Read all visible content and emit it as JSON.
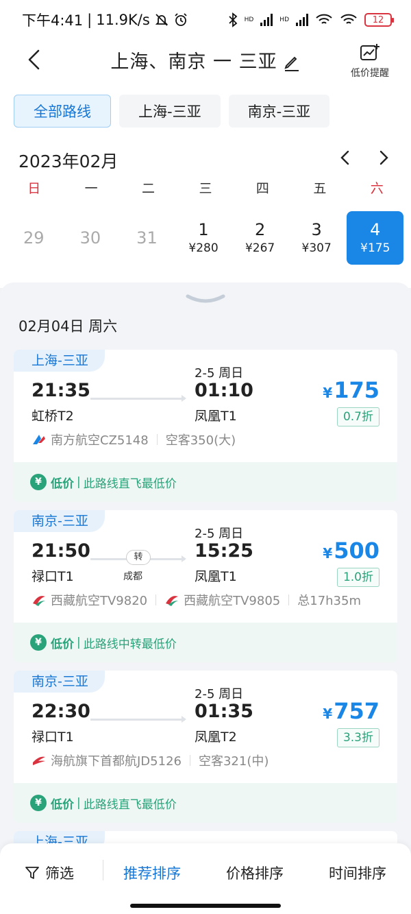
{
  "status_bar": {
    "time": "下午4:41",
    "speed": "11.9K/s",
    "battery": "12",
    "hd1": "HD",
    "hd2": "HD"
  },
  "header": {
    "title": "上海、南京 一 三亚",
    "alert_label": "低价提醒"
  },
  "route_tabs": [
    {
      "label": "全部路线",
      "active": true
    },
    {
      "label": "上海-三亚",
      "active": false
    },
    {
      "label": "南京-三亚",
      "active": false
    }
  ],
  "calendar": {
    "month": "2023年02月",
    "weekdays": [
      "日",
      "一",
      "二",
      "三",
      "四",
      "五",
      "六"
    ],
    "days": [
      {
        "num": "29",
        "price": ""
      },
      {
        "num": "30",
        "price": ""
      },
      {
        "num": "31",
        "price": ""
      },
      {
        "num": "1",
        "price": "¥280"
      },
      {
        "num": "2",
        "price": "¥267"
      },
      {
        "num": "3",
        "price": "¥307"
      },
      {
        "num": "4",
        "price": "¥175"
      }
    ]
  },
  "results": {
    "date_heading": "02月04日 周六",
    "flights": [
      {
        "route": "上海-三亚",
        "dep_time": "21:35",
        "dep_airport": "虹桥T2",
        "arr_date": "2-5 周日",
        "arr_time": "01:10",
        "arr_airport": "凤凰T1",
        "price_symbol": "¥",
        "price": "175",
        "discount": "0.7折",
        "airline": "南方航空CZ5148",
        "aircraft": "空客350(大)",
        "tag_strong": "低价",
        "tag_text": "此路线直飞最低价"
      },
      {
        "route": "南京-三亚",
        "dep_time": "21:50",
        "dep_airport": "禄口T1",
        "arr_date": "2-5 周日",
        "arr_time": "15:25",
        "arr_airport": "凤凰T1",
        "transfer": "转",
        "transfer_city": "成都",
        "price_symbol": "¥",
        "price": "500",
        "discount": "1.0折",
        "airline": "西藏航空TV9820",
        "airline2": "西藏航空TV9805",
        "duration": "总17h35m",
        "tag_strong": "低价",
        "tag_text": "此路线中转最低价"
      },
      {
        "route": "南京-三亚",
        "dep_time": "22:30",
        "dep_airport": "禄口T1",
        "arr_date": "2-5 周日",
        "arr_time": "01:35",
        "arr_airport": "凤凰T2",
        "price_symbol": "¥",
        "price": "757",
        "discount": "3.3折",
        "airline": "海航旗下首都航JD5126",
        "aircraft": "空客321(中)",
        "tag_strong": "低价",
        "tag_text": "此路线直飞最低价"
      }
    ],
    "peek_route": "上海-三亚"
  },
  "bottom_bar": {
    "filter": "筛选",
    "recommended": "推荐排序",
    "price_sort": "价格排序",
    "time_sort": "时间排序"
  },
  "colors": {
    "accent": "#1a86e6",
    "green": "#2aa37a",
    "red": "#d9333f"
  }
}
